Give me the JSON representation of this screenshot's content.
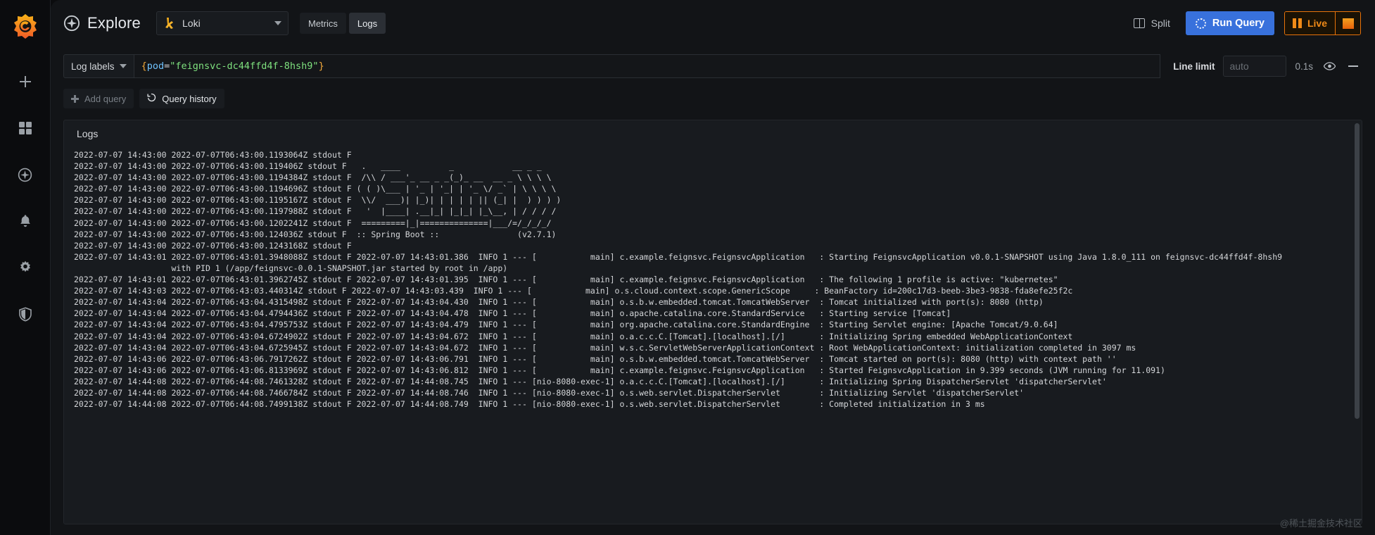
{
  "rail": {
    "logo_name": "grafana-logo",
    "items": [
      {
        "name": "add-icon",
        "label": "Add"
      },
      {
        "name": "dashboards-icon",
        "label": "Dashboards"
      },
      {
        "name": "explore-compass-icon",
        "label": "Explore"
      },
      {
        "name": "alerting-bell-icon",
        "label": "Alerting"
      },
      {
        "name": "configuration-gear-icon",
        "label": "Configuration"
      },
      {
        "name": "server-admin-shield-icon",
        "label": "Server Admin"
      }
    ]
  },
  "topbar": {
    "title": "Explore",
    "datasource": {
      "name": "Loki",
      "logo": "loki-logo"
    },
    "modes": [
      {
        "id": "metrics",
        "label": "Metrics",
        "active": false
      },
      {
        "id": "logs",
        "label": "Logs",
        "active": true
      }
    ],
    "split_label": "Split",
    "run_query_label": "Run Query",
    "live_label": "Live",
    "stop_label": "Stop",
    "accent_blue": "#3871dc",
    "accent_orange": "#e8730a"
  },
  "query": {
    "log_labels_label": "Log labels",
    "expr_brace_open": "{",
    "expr_key": "pod",
    "expr_eq": "=",
    "expr_value": "\"feignsvc-dc44ffd4f-8hsh9\"",
    "expr_brace_close": "}",
    "line_limit_label": "Line limit",
    "line_limit_placeholder": "auto",
    "line_limit_value": "",
    "refresh_interval": "0.1s",
    "eye_icon": "eye-icon",
    "collapse_icon": "minus-icon"
  },
  "actions": {
    "add_query_label": "Add query",
    "query_history_label": "Query history"
  },
  "logs": {
    "title": "Logs",
    "lines": [
      "2022-07-07 14:43:00 2022-07-07T06:43:00.1193064Z stdout F",
      "2022-07-07 14:43:00 2022-07-07T06:43:00.119406Z stdout F   .   ____          _            __ _ _",
      "2022-07-07 14:43:00 2022-07-07T06:43:00.1194384Z stdout F  /\\\\ / ___'_ __ _ _(_)_ __  __ _ \\ \\ \\ \\",
      "2022-07-07 14:43:00 2022-07-07T06:43:00.1194696Z stdout F ( ( )\\___ | '_ | '_| | '_ \\/ _` | \\ \\ \\ \\",
      "2022-07-07 14:43:00 2022-07-07T06:43:00.1195167Z stdout F  \\\\/  ___)| |_)| | | | | || (_| |  ) ) ) )",
      "2022-07-07 14:43:00 2022-07-07T06:43:00.1197988Z stdout F   '  |____| .__|_| |_|_| |_\\__, | / / / /",
      "2022-07-07 14:43:00 2022-07-07T06:43:00.1202241Z stdout F  =========|_|==============|___/=/_/_/_/",
      "2022-07-07 14:43:00 2022-07-07T06:43:00.124036Z stdout F  :: Spring Boot ::                (v2.7.1)",
      "2022-07-07 14:43:00 2022-07-07T06:43:00.1243168Z stdout F",
      "2022-07-07 14:43:01 2022-07-07T06:43:01.3948088Z stdout F 2022-07-07 14:43:01.386  INFO 1 --- [           main] c.example.feignsvc.FeignsvcApplication   : Starting FeignsvcApplication v0.0.1-SNAPSHOT using Java 1.8.0_111 on feignsvc-dc44ffd4f-8hsh9\n                    with PID 1 (/app/feignsvc-0.0.1-SNAPSHOT.jar started by root in /app)",
      "2022-07-07 14:43:01 2022-07-07T06:43:01.3962745Z stdout F 2022-07-07 14:43:01.395  INFO 1 --- [           main] c.example.feignsvc.FeignsvcApplication   : The following 1 profile is active: \"kubernetes\"",
      "2022-07-07 14:43:03 2022-07-07T06:43:03.440314Z stdout F 2022-07-07 14:43:03.439  INFO 1 --- [           main] o.s.cloud.context.scope.GenericScope     : BeanFactory id=200c17d3-beeb-3be3-9838-fda8efe25f2c",
      "2022-07-07 14:43:04 2022-07-07T06:43:04.4315498Z stdout F 2022-07-07 14:43:04.430  INFO 1 --- [           main] o.s.b.w.embedded.tomcat.TomcatWebServer  : Tomcat initialized with port(s): 8080 (http)",
      "2022-07-07 14:43:04 2022-07-07T06:43:04.4794436Z stdout F 2022-07-07 14:43:04.478  INFO 1 --- [           main] o.apache.catalina.core.StandardService   : Starting service [Tomcat]",
      "2022-07-07 14:43:04 2022-07-07T06:43:04.4795753Z stdout F 2022-07-07 14:43:04.479  INFO 1 --- [           main] org.apache.catalina.core.StandardEngine  : Starting Servlet engine: [Apache Tomcat/9.0.64]",
      "2022-07-07 14:43:04 2022-07-07T06:43:04.6724902Z stdout F 2022-07-07 14:43:04.672  INFO 1 --- [           main] o.a.c.c.C.[Tomcat].[localhost].[/]       : Initializing Spring embedded WebApplicationContext",
      "2022-07-07 14:43:04 2022-07-07T06:43:04.6725945Z stdout F 2022-07-07 14:43:04.672  INFO 1 --- [           main] w.s.c.ServletWebServerApplicationContext : Root WebApplicationContext: initialization completed in 3097 ms",
      "2022-07-07 14:43:06 2022-07-07T06:43:06.7917262Z stdout F 2022-07-07 14:43:06.791  INFO 1 --- [           main] o.s.b.w.embedded.tomcat.TomcatWebServer  : Tomcat started on port(s): 8080 (http) with context path ''",
      "2022-07-07 14:43:06 2022-07-07T06:43:06.8133969Z stdout F 2022-07-07 14:43:06.812  INFO 1 --- [           main] c.example.feignsvc.FeignsvcApplication   : Started FeignsvcApplication in 9.399 seconds (JVM running for 11.091)",
      "2022-07-07 14:44:08 2022-07-07T06:44:08.7461328Z stdout F 2022-07-07 14:44:08.745  INFO 1 --- [nio-8080-exec-1] o.a.c.c.C.[Tomcat].[localhost].[/]       : Initializing Spring DispatcherServlet 'dispatcherServlet'",
      "2022-07-07 14:44:08 2022-07-07T06:44:08.7466784Z stdout F 2022-07-07 14:44:08.746  INFO 1 --- [nio-8080-exec-1] o.s.web.servlet.DispatcherServlet        : Initializing Servlet 'dispatcherServlet'",
      "2022-07-07 14:44:08 2022-07-07T06:44:08.7499138Z stdout F 2022-07-07 14:44:08.749  INFO 1 --- [nio-8080-exec-1] o.s.web.servlet.DispatcherServlet        : Completed initialization in 3 ms"
    ]
  },
  "watermark": "@稀土掘金技术社区"
}
